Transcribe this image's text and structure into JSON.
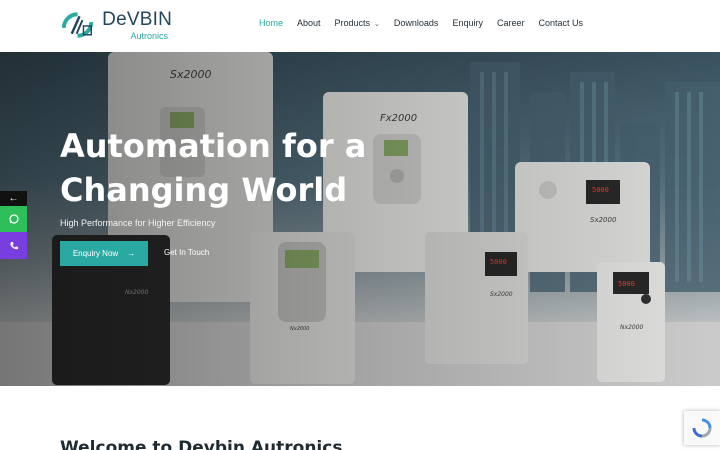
{
  "brand": {
    "name": "DeVBIN",
    "subtitle": "Autronics",
    "colors": {
      "accent": "#2aa9a3",
      "dark": "#24465c"
    }
  },
  "nav": {
    "items": [
      {
        "label": "Home",
        "active": true
      },
      {
        "label": "About",
        "active": false
      },
      {
        "label": "Products",
        "active": false,
        "dropdown": true
      },
      {
        "label": "Downloads",
        "active": false
      },
      {
        "label": "Enquiry",
        "active": false
      },
      {
        "label": "Career",
        "active": false
      },
      {
        "label": "Contact Us",
        "active": false
      }
    ]
  },
  "hero": {
    "title_line1": "Automation for a",
    "title_line2": "Changing World",
    "subtitle": "High Performance for Higher Efficiency",
    "primary_button": "Enquiry Now",
    "secondary_link": "Get In Touch",
    "product_labels": [
      "Sx2000",
      "Fx2000",
      "Sx2000",
      "Sx2000",
      "Nx2000",
      "Nx2000",
      "Nx2000"
    ],
    "displays": [
      "5000",
      "5000",
      "5000"
    ]
  },
  "side_buttons": {
    "icons": [
      "arrow-left-icon",
      "whatsapp-icon",
      "phone-icon"
    ]
  },
  "section": {
    "welcome_title": "Welcome to Devbin Autronics"
  }
}
